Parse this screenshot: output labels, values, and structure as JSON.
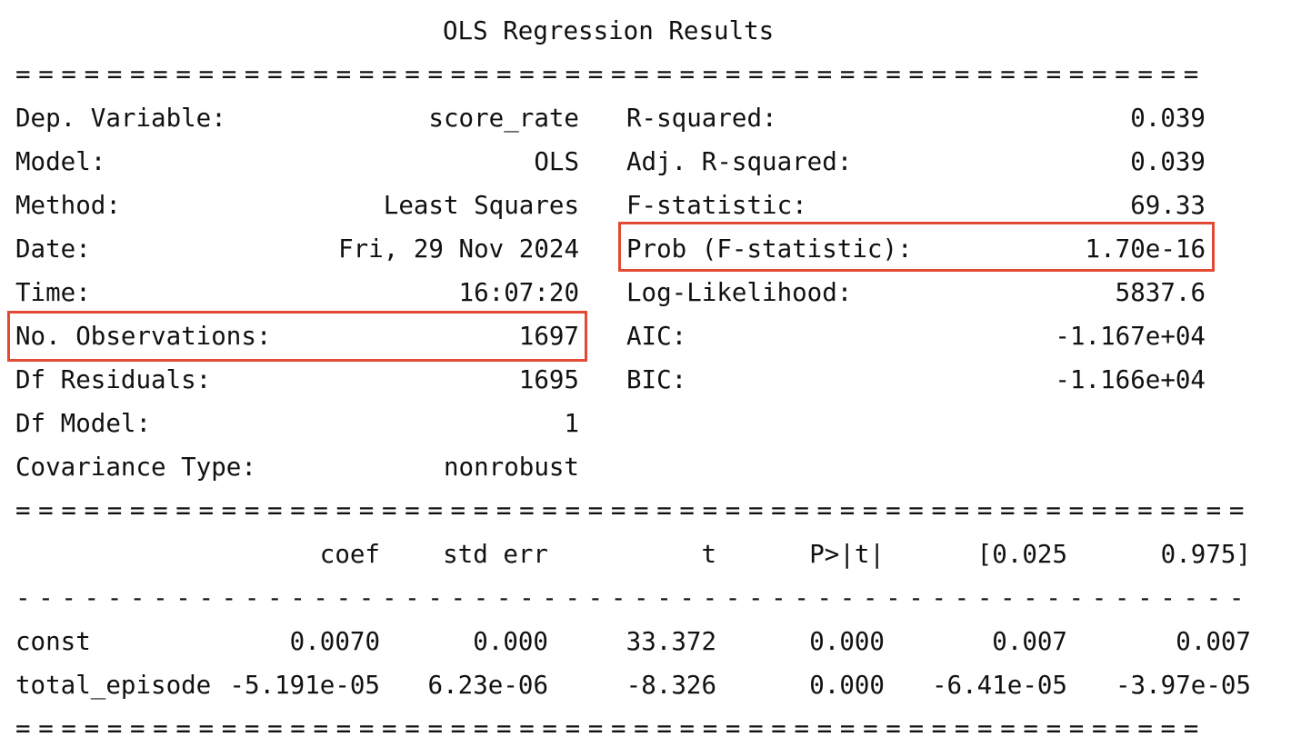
{
  "title": "OLS Regression Results",
  "separators": {
    "double_short": "====================================================",
    "double_long": "======================================================",
    "single_long": "------------------------------------------------------",
    "double_end": "===================================================="
  },
  "left_rows": [
    {
      "label": "Dep. Variable:",
      "value": "score_rate"
    },
    {
      "label": "Model:",
      "value": "OLS"
    },
    {
      "label": "Method:",
      "value": "Least Squares"
    },
    {
      "label": "Date:",
      "value": "Fri, 29 Nov 2024"
    },
    {
      "label": "Time:",
      "value": "16:07:20"
    },
    {
      "label": "No. Observations:",
      "value": "1697"
    },
    {
      "label": "Df Residuals:",
      "value": "1695"
    },
    {
      "label": "Df Model:",
      "value": "1"
    },
    {
      "label": "Covariance Type:",
      "value": "nonrobust"
    }
  ],
  "right_rows": [
    {
      "label": "R-squared:",
      "value": "0.039"
    },
    {
      "label": "Adj. R-squared:",
      "value": "0.039"
    },
    {
      "label": "F-statistic:",
      "value": "69.33"
    },
    {
      "label": "Prob (F-statistic):",
      "value": "1.70e-16"
    },
    {
      "label": "Log-Likelihood:",
      "value": "5837.6"
    },
    {
      "label": "AIC:",
      "value": "-1.167e+04"
    },
    {
      "label": "BIC:",
      "value": "-1.166e+04"
    }
  ],
  "coef_table": {
    "headers": [
      "coef",
      "std err",
      "t",
      "P>|t|",
      "[0.025",
      "0.975]"
    ],
    "rows": [
      {
        "name": "const",
        "cells": [
          "0.0070",
          "0.000",
          "33.372",
          "0.000",
          "0.007",
          "0.007"
        ]
      },
      {
        "name": "total_episode",
        "cells": [
          "-5.191e-05",
          "6.23e-06",
          "-8.326",
          "0.000",
          "-6.41e-05",
          "-3.97e-05"
        ]
      }
    ]
  },
  "highlight_color": "#e24a33"
}
